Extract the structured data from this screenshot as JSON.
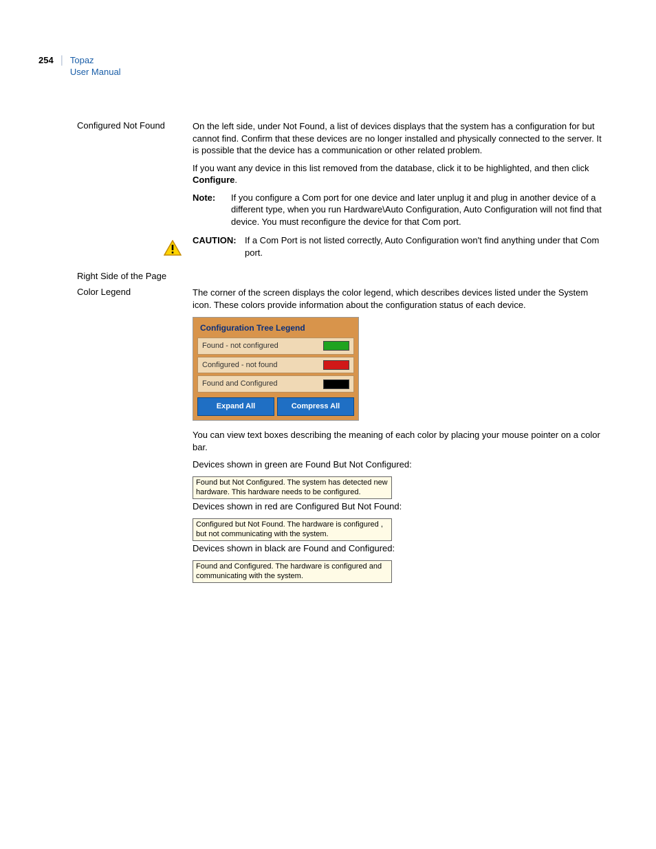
{
  "header": {
    "page_number": "254",
    "title_line1": "Topaz",
    "title_line2": "User Manual"
  },
  "section1": {
    "label": "Configured Not Found",
    "para1": "On the left side, under Not Found, a list of devices displays that the system has a configuration for but cannot find. Confirm that these devices are no longer installed and physically connected to the server. It is possible that the device has a communication or other related problem.",
    "para2a": "If you want any device in this list removed from the database, click it to be highlighted, and then click ",
    "para2b": "Configure",
    "para2c": ".",
    "note_label": "Note:",
    "note_text": "If you configure a Com port for one device and later unplug it and plug in another device of a different type, when you run Hardware\\Auto Configuration, Auto Configuration will not find that device. You must reconfigure the device for that Com port.",
    "caution_label": "CAUTION:",
    "caution_text": "If a Com Port is not listed correctly, Auto Configuration won't find anything under that Com port."
  },
  "section2": {
    "label": "Right Side of the Page"
  },
  "section3": {
    "label": "Color Legend",
    "para1": "The corner of the screen displays the color legend, which describes devices listed under the System icon. These colors provide information about the configuration status of each device.",
    "legend": {
      "title": "Configuration Tree Legend",
      "rows": [
        {
          "label": "Found - not configured",
          "color": "#1fa31f"
        },
        {
          "label": "Configured - not found",
          "color": "#d11818"
        },
        {
          "label": "Found and Configured",
          "color": "#000000"
        }
      ],
      "btn_expand": "Expand All",
      "btn_compress": "Compress All"
    },
    "para2": "You can view text boxes describing the meaning of each color by placing your mouse pointer on a color bar.",
    "green_label": "Devices shown in green are Found But Not Configured:",
    "green_tooltip": "Found but Not Configured.  The system has detected new hardware.  This hardware needs to be configured.",
    "red_label": "Devices shown in red are Configured But Not Found:",
    "red_tooltip": "Configured but Not Found.  The hardware is configured , but not communicating with the system.",
    "black_label": "Devices shown in black are Found and Configured:",
    "black_tooltip": "Found and Configured.  The hardware is configured and communicating with the system."
  }
}
